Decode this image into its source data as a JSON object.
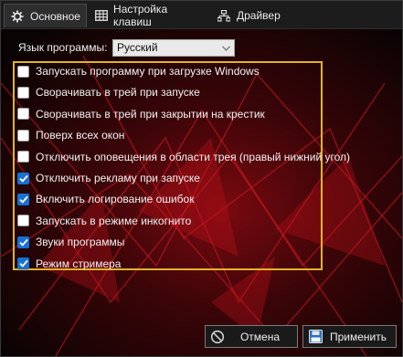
{
  "tabs": {
    "main": "Основное",
    "keys": "Настройка клавиш",
    "driver": "Драйвер"
  },
  "language": {
    "label": "Язык программы:",
    "value": "Русский"
  },
  "options": [
    {
      "label": "Запускать программу при загрузке Windows",
      "checked": false
    },
    {
      "label": "Сворачивать в трей при запуске",
      "checked": false
    },
    {
      "label": "Сворачивать в трей при закрытии на крестик",
      "checked": false
    },
    {
      "label": "Поверх всех окон",
      "checked": false
    },
    {
      "label": "Отключить оповещения в области трея (правый нижний угол)",
      "checked": false
    },
    {
      "label": "Отключить рекламу при запуске",
      "checked": true
    },
    {
      "label": "Включить логирование ошибок",
      "checked": true
    },
    {
      "label": "Запускать в режиме инкогнито",
      "checked": false
    },
    {
      "label": "Звуки программы",
      "checked": true
    },
    {
      "label": "Режим стримера",
      "checked": true
    }
  ],
  "buttons": {
    "cancel": "Отмена",
    "apply": "Применить"
  },
  "colors": {
    "accent": "#e2b22a",
    "checkbox_checked": "#1670d6"
  }
}
